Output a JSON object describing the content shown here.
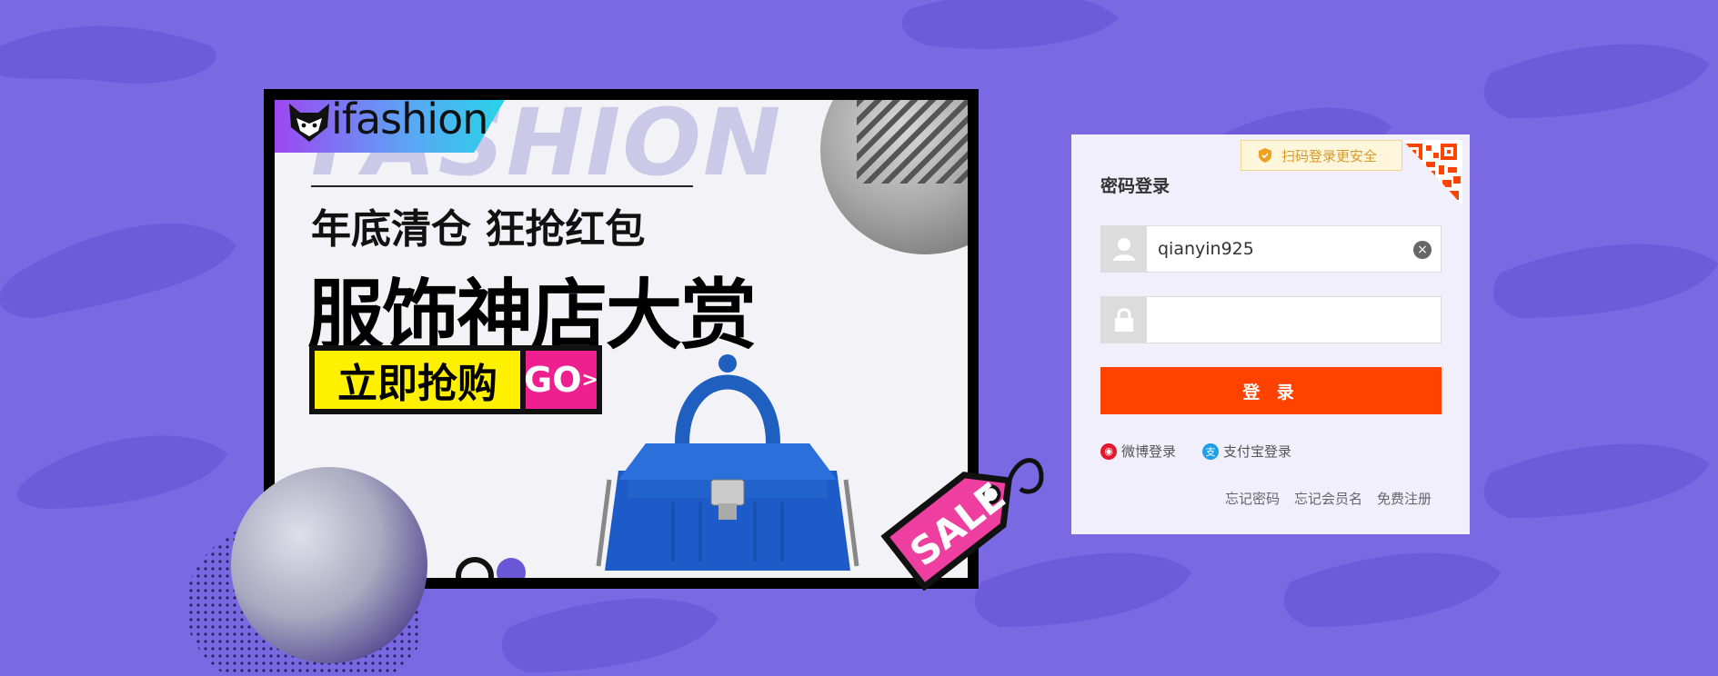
{
  "banner": {
    "logo_text": "ifashion",
    "watermark": "FASHION",
    "headline_small": "年底清仓 狂抢红包",
    "headline_big": "服饰神店大赏",
    "cta_label": "立即抢购",
    "cta_go": "GO",
    "sale_tag": "SALE"
  },
  "login": {
    "qr_tip": "扫码登录更安全",
    "title": "密码登录",
    "username_value": "qianyin925",
    "password_value": "",
    "submit_label": "登 录",
    "alt": {
      "weibo": "微博登录",
      "alipay": "支付宝登录"
    },
    "links": {
      "forgot_password": "忘记密码",
      "forgot_member": "忘记会员名",
      "register": "免费注册"
    }
  },
  "colors": {
    "background": "#7b68e3",
    "submit_button": "#ff4200",
    "cta_yellow": "#fff000",
    "cta_pink": "#ee1f8f",
    "sale_pink": "#ee3ea0"
  },
  "icons": [
    "fox-logo-icon",
    "user-icon",
    "lock-icon",
    "clear-icon",
    "shield-icon",
    "qr-code-icon",
    "weibo-icon",
    "alipay-icon"
  ]
}
